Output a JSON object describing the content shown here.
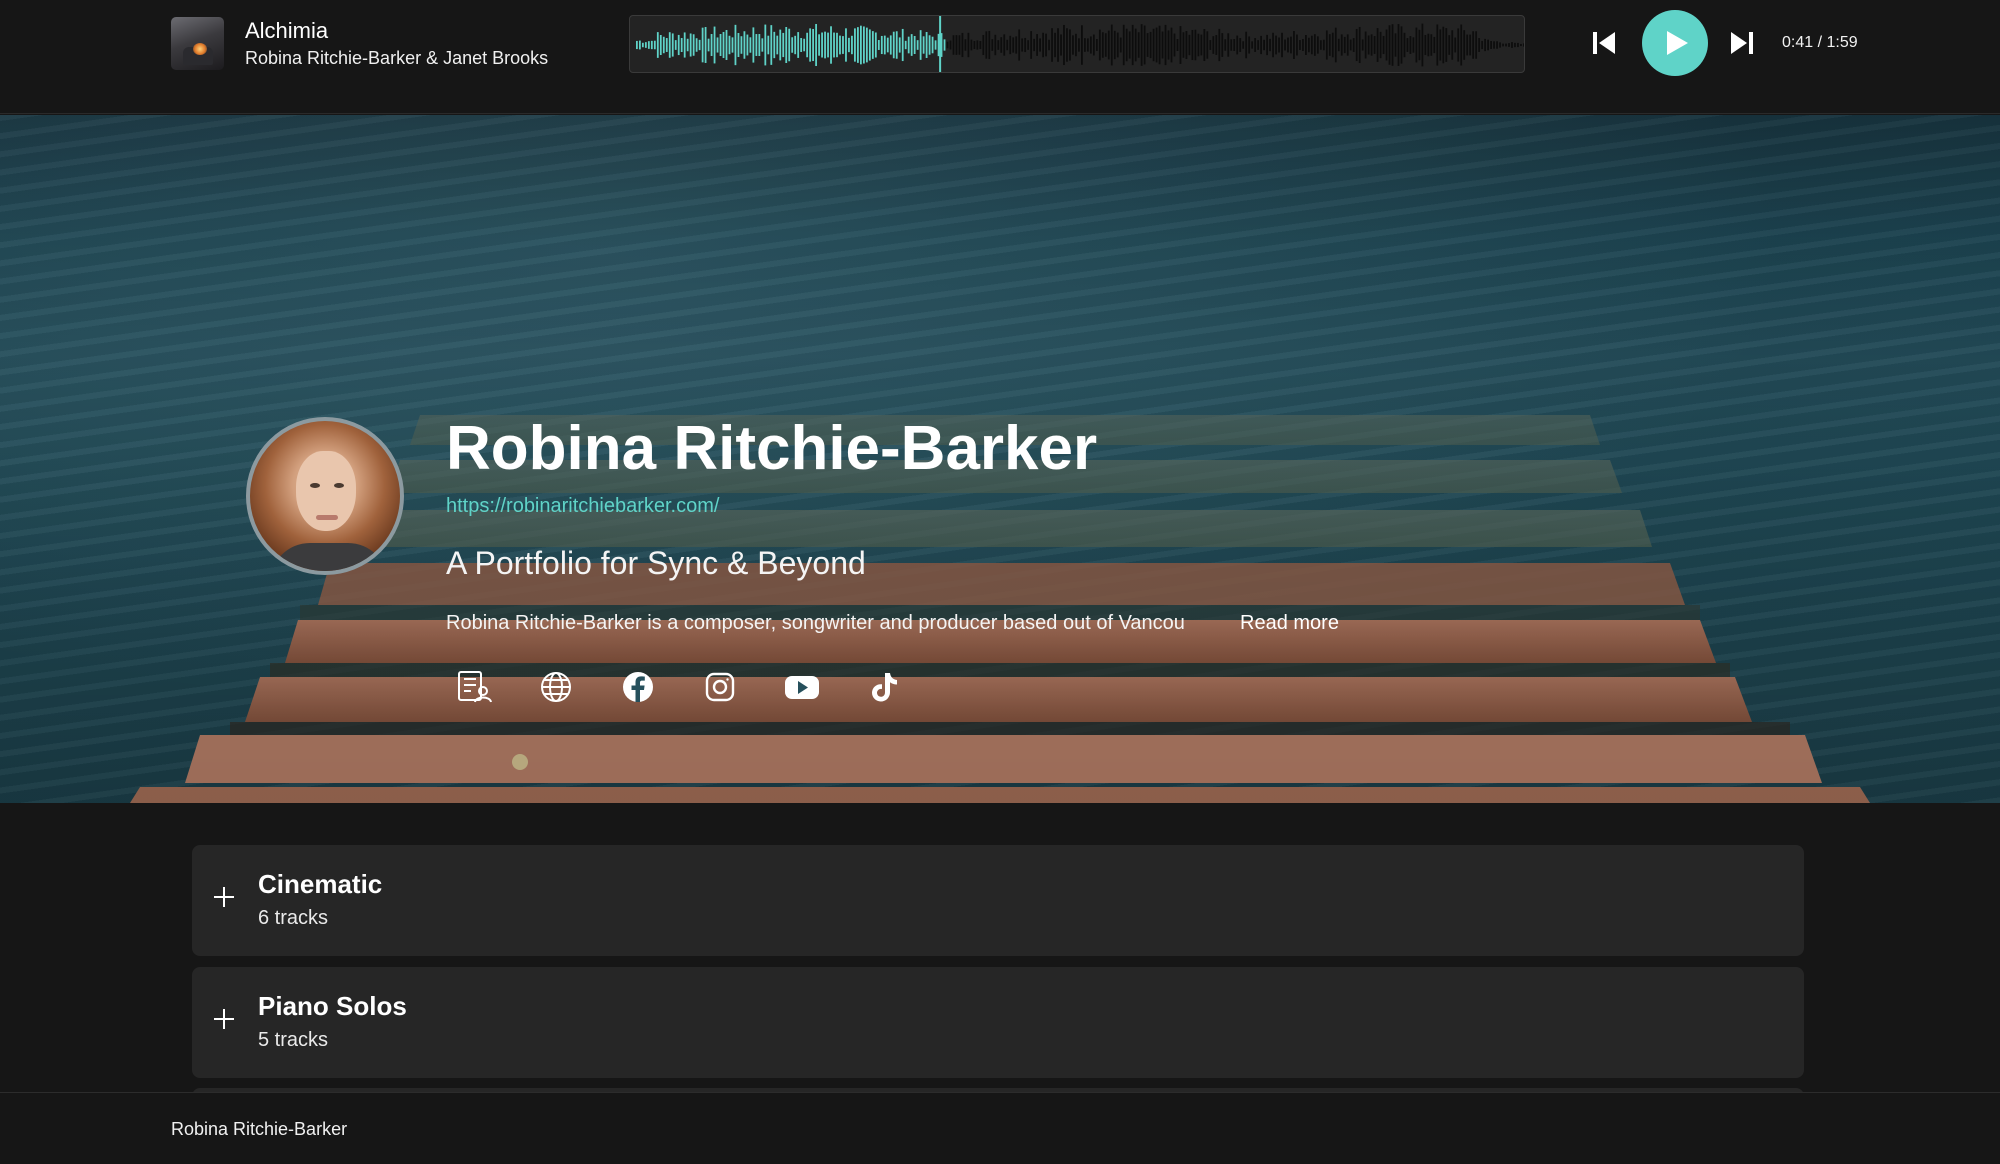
{
  "player": {
    "track_title": "Alchimia",
    "track_artist": "Robina Ritchie-Barker & Janet Brooks",
    "time_display": "0:41 / 1:59",
    "progress_fraction": 0.345,
    "accent_color": "#5fd3c8",
    "icons": {
      "previous": "skip-previous-icon",
      "play": "play-icon",
      "next": "skip-next-icon",
      "artwork": "album-art"
    }
  },
  "profile": {
    "name": "Robina Ritchie-Barker",
    "website": "https://robinaritchiebarker.com/",
    "tagline": "A Portfolio for Sync & Beyond",
    "bio_preview": "Robina Ritchie-Barker is a composer, songwriter and producer based out of Vancou",
    "read_more_label": "Read more",
    "social_icons": [
      "bio-profile-icon",
      "globe-icon",
      "facebook-icon",
      "instagram-icon",
      "youtube-icon",
      "tiktok-icon"
    ]
  },
  "collections": [
    {
      "name": "Cinematic",
      "track_count": "6 tracks"
    },
    {
      "name": "Piano Solos",
      "track_count": "5 tracks"
    }
  ],
  "footer": {
    "artist_name": "Robina Ritchie-Barker"
  }
}
